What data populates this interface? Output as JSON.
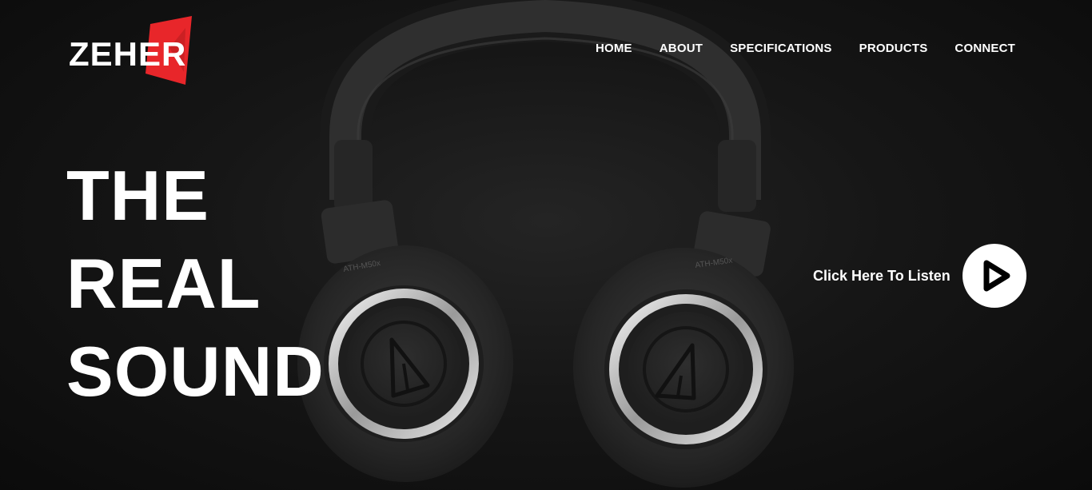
{
  "brand": {
    "logo_text": "ZEHER",
    "accent_color": "#e8262a"
  },
  "nav": {
    "items": [
      {
        "label": "HOME"
      },
      {
        "label": "ABOUT"
      },
      {
        "label": "SPECIFICATIONS"
      },
      {
        "label": "PRODUCTS"
      },
      {
        "label": "CONNECT"
      }
    ]
  },
  "hero": {
    "headline_lines": [
      "THE",
      "REAL",
      "SOUND"
    ],
    "cta_label": "Click Here To Listen",
    "cta_icon": "play-icon",
    "image_subject": "headphones",
    "earcup_label_left": "ATH-M50x",
    "earcup_label_right": "ATH-M50x"
  }
}
